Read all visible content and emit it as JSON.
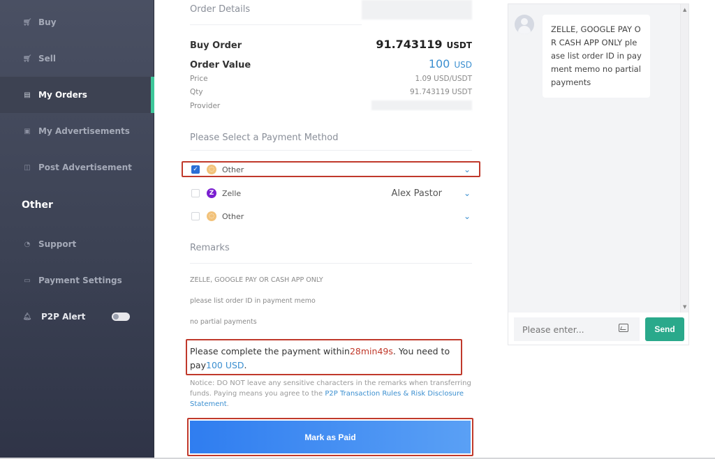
{
  "sidebar": {
    "items": [
      {
        "label": "Buy",
        "icon": "cart-icon"
      },
      {
        "label": "Sell",
        "icon": "cart-icon"
      },
      {
        "label": "My Orders",
        "icon": "document-icon",
        "active": true
      },
      {
        "label": "My Advertisements",
        "icon": "ad-icon"
      },
      {
        "label": "Post Advertisement",
        "icon": "post-icon"
      }
    ],
    "section_label": "Other",
    "other_items": [
      {
        "label": "Support",
        "icon": "support-icon"
      },
      {
        "label": "Payment Settings",
        "icon": "card-icon"
      },
      {
        "label": "P2P Alert",
        "icon": "bell-icon"
      }
    ],
    "p2p_alert_enabled": false,
    "accent_color": "#3ec79a"
  },
  "order": {
    "section_title": "Order Details",
    "buy_order_label": "Buy Order",
    "buy_order_value": "91.743119",
    "buy_order_unit": "USDT",
    "order_value_label": "Order Value",
    "order_value_value": "100",
    "order_value_unit": "USD",
    "price_label": "Price",
    "price_value": "1.09 USD/USDT",
    "qty_label": "Qty",
    "qty_value": "91.743119 USDT",
    "provider_label": "Provider"
  },
  "payment": {
    "section_title": "Please Select a Payment Method",
    "methods": [
      {
        "name": "Other",
        "holder": "",
        "checked": true,
        "icon": "other-payment-icon"
      },
      {
        "name": "Zelle",
        "holder": "Alex Pastor",
        "checked": false,
        "icon": "zelle-icon"
      },
      {
        "name": "Other",
        "holder": "",
        "checked": false,
        "icon": "other-payment-icon"
      }
    ]
  },
  "remarks": {
    "section_title": "Remarks",
    "lines": [
      "ZELLE, GOOGLE PAY OR CASH APP ONLY",
      "please list order ID in payment memo",
      "no partial payments"
    ]
  },
  "countdown": {
    "prefix": "Please complete the payment within",
    "time": "28min49s",
    "middle": ". You need to pay",
    "amount": "100 USD",
    "suffix": "."
  },
  "notice": {
    "text": "Notice: DO NOT leave any sensitive characters in the remarks when transferring funds. Paying means you agree to the ",
    "link": "P2P Transaction Rules & Risk Disclosure Statement",
    "suffix": "."
  },
  "mark_paid_label": "Mark as Paid",
  "chat": {
    "message": "ZELLE, GOOGLE PAY OR CASH APP ONLY please list order ID in payment memo no partial payments",
    "input_placeholder": "Please enter...",
    "send_label": "Send",
    "scroll_up": "▲",
    "scroll_down": "▼"
  }
}
